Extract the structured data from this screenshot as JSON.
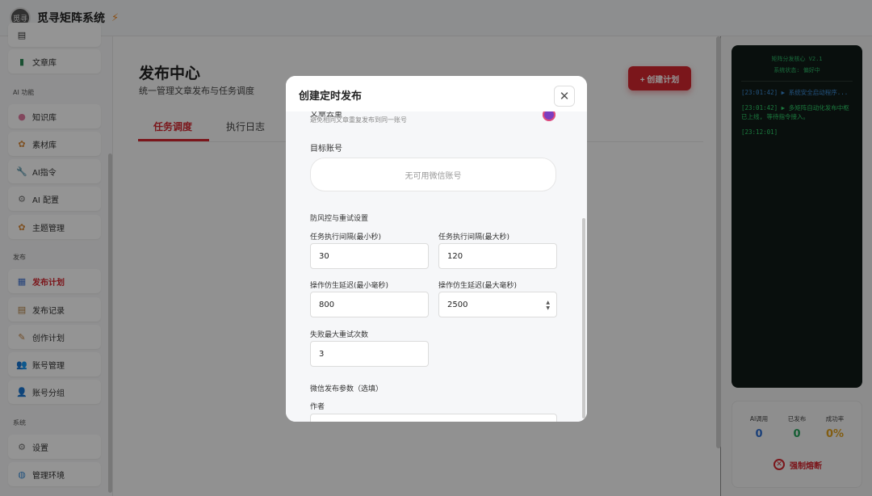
{
  "app": {
    "title": "觅寻矩阵系统",
    "logo_text": "觅寻"
  },
  "sidebar": {
    "sections": [
      "AI 功能",
      "发布",
      "系统"
    ],
    "items": [
      {
        "label": "",
        "icon": "folder-icon"
      },
      {
        "label": "文章库",
        "icon": "books-icon"
      },
      {
        "label": "知识库",
        "icon": "brain-icon"
      },
      {
        "label": "素材库",
        "icon": "palette-icon"
      },
      {
        "label": "AI指令",
        "icon": "wrench-icon"
      },
      {
        "label": "AI 配置",
        "icon": "gear-icon"
      },
      {
        "label": "主题管理",
        "icon": "palette-icon"
      },
      {
        "label": "发布计划",
        "icon": "calendar-icon",
        "active": true
      },
      {
        "label": "发布记录",
        "icon": "clipboard-icon"
      },
      {
        "label": "创作计划",
        "icon": "memo-icon"
      },
      {
        "label": "账号管理",
        "icon": "users-icon"
      },
      {
        "label": "账号分组",
        "icon": "user-icon"
      },
      {
        "label": "设置",
        "icon": "gear-icon"
      },
      {
        "label": "管理环境",
        "icon": "globe-icon"
      }
    ]
  },
  "main": {
    "title": "发布中心",
    "subtitle": "统一管理文章发布与任务调度",
    "tabs": [
      {
        "label": "任务调度",
        "active": true
      },
      {
        "label": "执行日志"
      }
    ],
    "create_label": "+ 创建计划"
  },
  "terminal": {
    "title": "矩阵分发核心 V2.1",
    "status": "系统状态: 偏好中",
    "lines": [
      {
        "time": "[23:01:42]",
        "text": "▶ 系统安全启动程序...",
        "color": "#3b8ed8"
      },
      {
        "time": "[23:01:42]",
        "text": "▶ 多矩阵自动化发布中枢已上线, 等待指令接入。",
        "color": "#2ed06a"
      },
      {
        "time": "[23:12:01]",
        "text": "",
        "color": "#2ed06a"
      }
    ]
  },
  "stats": {
    "items": [
      {
        "label": "AI调用",
        "value": "0",
        "color": "#2f6fd0"
      },
      {
        "label": "已发布",
        "value": "0",
        "color": "#25a35a"
      },
      {
        "label": "成功率",
        "value": "0%",
        "color": "#e0a020"
      }
    ],
    "fuse_label": "强制熔断"
  },
  "modal": {
    "title": "创建定时发布",
    "dedupe_label": "文章去重",
    "dedupe_hint": "避免相同文章重复发布到同一账号",
    "target_label": "目标账号",
    "target_placeholder": "无可用微信账号",
    "risk_section": "防风控与重试设置",
    "fields": {
      "min_interval": {
        "label": "任务执行间隔(最小秒)",
        "value": "30"
      },
      "max_interval": {
        "label": "任务执行间隔(最大秒)",
        "value": "120"
      },
      "min_delay": {
        "label": "操作仿生延迟(最小毫秒)",
        "value": "800"
      },
      "max_delay": {
        "label": "操作仿生延迟(最大毫秒)",
        "value": "2500"
      },
      "max_retry": {
        "label": "失败最大重试次数",
        "value": "3"
      }
    },
    "wechat_section": "微信发布参数（选填）",
    "author_label": "作者"
  }
}
